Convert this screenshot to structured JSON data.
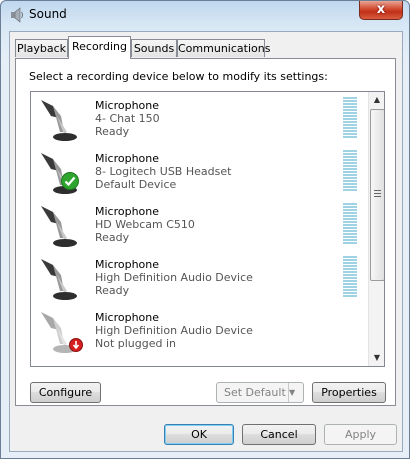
{
  "window": {
    "title": "Sound",
    "close_label": "x"
  },
  "tabs": [
    {
      "label": "Playback",
      "active": false
    },
    {
      "label": "Recording",
      "active": true
    },
    {
      "label": "Sounds",
      "active": false
    },
    {
      "label": "Communications",
      "active": false
    }
  ],
  "panel": {
    "instruction": "Select a recording device below to modify its settings:",
    "devices": [
      {
        "name": "Microphone",
        "description": "4- Chat 150",
        "status": "Ready",
        "badge": "none"
      },
      {
        "name": "Microphone",
        "description": "8- Logitech USB Headset",
        "status": "Default Device",
        "badge": "green-check"
      },
      {
        "name": "Microphone",
        "description": "HD Webcam C510",
        "status": "Ready",
        "badge": "none"
      },
      {
        "name": "Microphone",
        "description": "High Definition Audio Device",
        "status": "Ready",
        "badge": "none"
      },
      {
        "name": "Microphone",
        "description": "High Definition Audio Device",
        "status": "Not plugged in",
        "badge": "red-unplugged"
      }
    ],
    "buttons": {
      "configure": "Configure",
      "set_default": "Set Default",
      "properties": "Properties"
    }
  },
  "dialog_buttons": {
    "ok": "OK",
    "cancel": "Cancel",
    "apply": "Apply"
  },
  "colors": {
    "level_meter": "#9fd3e3",
    "default_check": "#2fa52f",
    "unplugged_badge": "#d42020"
  }
}
